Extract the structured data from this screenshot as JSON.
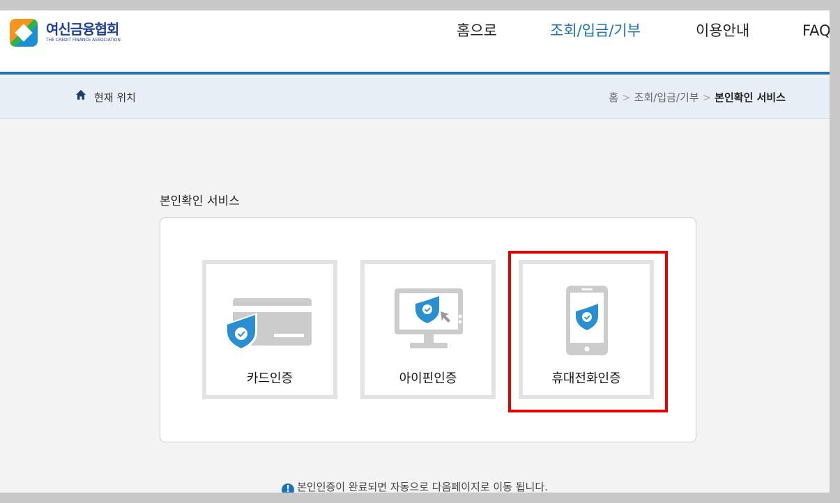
{
  "logo": {
    "name_kr": "여신금융협회",
    "name_en": "THE CREDIT FINANCE ASSOCIATION"
  },
  "nav": {
    "items": [
      {
        "label": "홈으로"
      },
      {
        "label": "조회/입금/기부",
        "active": true
      },
      {
        "label": "이용안내"
      },
      {
        "label": "FAQ"
      }
    ]
  },
  "location": {
    "label": "현재 위치",
    "breadcrumb": [
      "홈",
      "조회/입금/기부",
      "본인확인 서비스"
    ],
    "separator": ">"
  },
  "section": {
    "title": "본인확인 서비스"
  },
  "auth_options": [
    {
      "label": "카드인증",
      "icon": "card-icon"
    },
    {
      "label": "아이핀인증",
      "icon": "monitor-icon"
    },
    {
      "label": "휴대전화인증",
      "icon": "mobile-phone-icon",
      "highlighted": true
    }
  ],
  "notice": {
    "icon": "info-icon",
    "text": "본인인증이 완료되면 자동으로 다음페이지로 이동 됩니다.",
    "icon_glyph": "!"
  },
  "colors": {
    "accent": "#1a73bb",
    "highlight": "#e50000",
    "icon_gray": "#cccccc",
    "shield": "#2a8fd0"
  }
}
